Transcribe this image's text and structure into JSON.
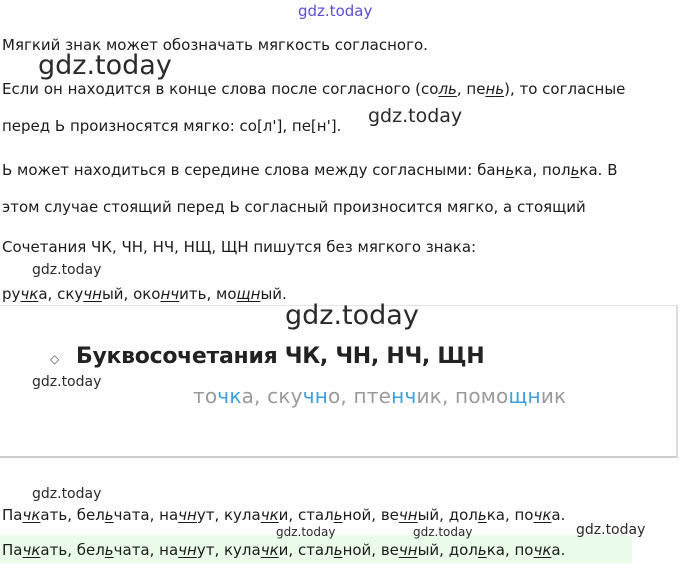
{
  "watermark": "gdz.today",
  "p1": "Мягкий знак может обозначать мягкость согласного.",
  "p2": {
    "a": "Если он находится в конце слова после согласного (со",
    "b": "л",
    "c": "ь",
    "d": ", пе",
    "e": "н",
    "f": "ь",
    "g": "), то согласные"
  },
  "p3": "перед Ь произносятся мягко: со[л'], пе[н'].",
  "p4": {
    "a": "Ь может находиться в середине слова между согласными: бан",
    "b": "ь",
    "c": "ка, пол",
    "d": "ь",
    "e": "ка. В"
  },
  "p5": "этом случае стоящий перед Ь согласный произносится мягко, а стоящий",
  "p6": "Сочетания ЧК, ЧН, НЧ, НЩ, ЩН пишутся без мягкого знака:",
  "p7": {
    "w1a": "ру",
    "w1b": "чк",
    "w1c": "а, ску",
    "w2b": "чн",
    "w2c": "ый, око",
    "w3b": "нч",
    "w3c": "ить, мо",
    "w4b": "щн",
    "w4c": "ый."
  },
  "card": {
    "title": "Буквосочетания ЧК, ЧН, НЧ, ЩН",
    "ex": {
      "a": "то",
      "b": "чк",
      "c": "а, ску",
      "d": "чн",
      "e": "о, пте",
      "f": "нч",
      "g": "ик, помо",
      "h": "щн",
      "i": "ик"
    }
  },
  "ans": {
    "a": "Па",
    "b": "чк",
    "c": "ать, бел",
    "d": "ь",
    "e": "чата, на",
    "f": "чн",
    "g": "ут, кула",
    "h": "чк",
    "i": "и, стал",
    "j": "ь",
    "k": "ной, ве",
    "l": "чн",
    "m": "ый, дол",
    "n": "ь",
    "o": "ка, по",
    "p": "чк",
    "q": "а."
  }
}
